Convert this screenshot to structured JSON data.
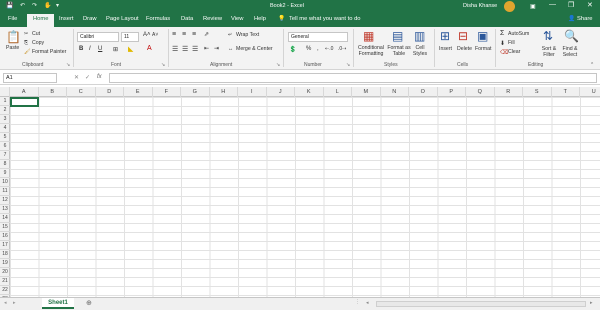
{
  "titlebar": {
    "document_title": "Book2 - Excel",
    "user_name": "Disha Khanse",
    "undo_icon": "undo-icon",
    "redo_icon": "redo-icon",
    "touch_icon": "touch-mode-icon",
    "customize_icon": "customize-qat-icon",
    "ribbon_options_icon": "ribbon-display-icon",
    "minimize": "—",
    "restore": "❐",
    "close": "✕"
  },
  "tabs": [
    "File",
    "Home",
    "Insert",
    "Draw",
    "Page Layout",
    "Formulas",
    "Data",
    "Review",
    "View",
    "Help"
  ],
  "active_tab": "Home",
  "tell_me": "Tell me what you want to do",
  "share": "Share",
  "ribbon": {
    "clipboard": {
      "label": "Clipboard",
      "paste": "Paste",
      "cut": "Cut",
      "copy": "Copy",
      "format_painter": "Format Painter"
    },
    "font": {
      "label": "Font",
      "font_name": "Calibri",
      "font_size": "11",
      "bold": "B",
      "italic": "I",
      "underline": "U",
      "grow": "A˄",
      "shrink": "A˅"
    },
    "alignment": {
      "label": "Alignment",
      "wrap_text": "Wrap Text",
      "merge_center": "Merge & Center"
    },
    "number": {
      "label": "Number",
      "format": "General",
      "percent": "%",
      "comma": ","
    },
    "styles": {
      "label": "Styles",
      "conditional_formatting": "Conditional Formatting",
      "format_as_table": "Format as Table",
      "cell_styles": "Cell Styles"
    },
    "cells": {
      "label": "Cells",
      "insert": "Insert",
      "delete": "Delete",
      "format": "Format"
    },
    "editing": {
      "label": "Editing",
      "autosum": "AutoSum",
      "fill": "Fill",
      "clear": "Clear",
      "sort_filter": "Sort & Filter",
      "find_select": "Find & Select"
    }
  },
  "formula_bar": {
    "name_box": "A1",
    "fx": "fx",
    "cancel": "✕",
    "enter": "✓",
    "value": ""
  },
  "grid": {
    "columns": [
      "A",
      "B",
      "C",
      "D",
      "E",
      "F",
      "G",
      "H",
      "I",
      "J",
      "K",
      "L",
      "M",
      "N",
      "O",
      "P",
      "Q",
      "R",
      "S",
      "T",
      "U"
    ],
    "rows": [
      "1",
      "2",
      "3",
      "4",
      "5",
      "6",
      "7",
      "8",
      "9",
      "10",
      "11",
      "12",
      "13",
      "14",
      "15",
      "16",
      "17",
      "18",
      "19",
      "20",
      "21",
      "22",
      "23"
    ],
    "active_cell": "A1"
  },
  "sheets": [
    "Sheet1"
  ],
  "add_sheet": "⊕",
  "colors": {
    "accent": "#217346",
    "ribbon_bg": "#f3f3f3",
    "grid_line": "#e2e2e2"
  }
}
